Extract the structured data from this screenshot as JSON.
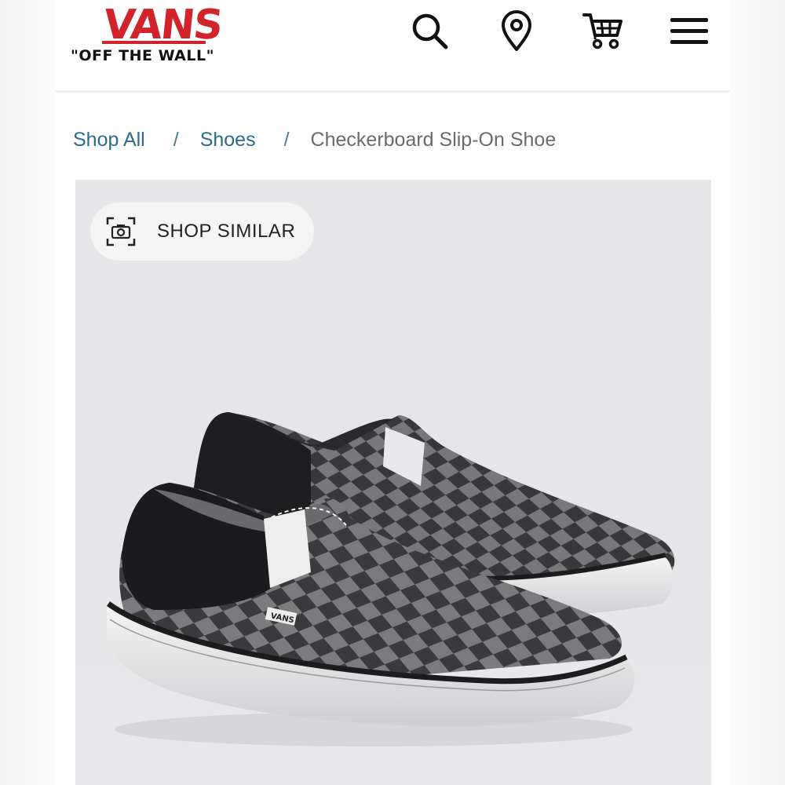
{
  "header": {
    "brand": "VANS",
    "tagline": "\"OFF THE WALL\"",
    "icons": [
      "search-icon",
      "location-pin-icon",
      "cart-icon",
      "menu-icon"
    ]
  },
  "breadcrumb": {
    "items": [
      "Shop All",
      "Shoes",
      "Checkerboard Slip-On Shoe"
    ],
    "separator": "/"
  },
  "product": {
    "shop_similar_label": "SHOP SIMILAR",
    "heel_tag": "VANS"
  },
  "colors": {
    "brand_red": "#d1232a",
    "link_blue": "#2b6b8f",
    "background_gray": "#e7e7ea"
  }
}
